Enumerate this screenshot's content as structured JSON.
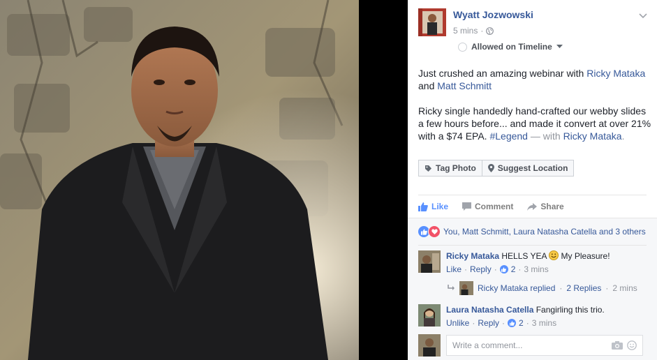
{
  "post": {
    "author": "Wyatt Jozwowski",
    "time": "5 mins",
    "dot": "·",
    "visibility": "Allowed on Timeline",
    "body_p1_prefix": "Just crushed an amazing webinar with ",
    "tag1": "Ricky Mataka",
    "and": " and ",
    "tag2": "Matt Schmitt",
    "body_p2": "Ricky single handedly hand-crafted our webby slides a few hours before... and made it convert at over 21% with a $74 EPA. ",
    "hashtag": "#Legend",
    "with_text": " — with ",
    "with_person": "Ricky Mataka",
    "with_end": ".",
    "tag_photo": "Tag Photo",
    "suggest_location": "Suggest Location"
  },
  "actions": {
    "like": "Like",
    "comment": "Comment",
    "share": "Share"
  },
  "reactions": {
    "text": "You, Matt Schmitt, Laura Natasha Catella and 3 others"
  },
  "comments": [
    {
      "name": "Ricky Mataka",
      "text": " HELLS YEA ",
      "text_after": " My Pleasure!",
      "action": "Like",
      "reply": "Reply",
      "likes": "2",
      "time": "3 mins",
      "sep": "·"
    },
    {
      "name": "Laura Natasha Catella",
      "text": " Fangirling this trio.",
      "action": "Unlike",
      "reply": "Reply",
      "likes": "2",
      "time": "3 mins",
      "sep": "·"
    }
  ],
  "reply_summary": {
    "text": "Ricky Mataka replied",
    "sep": "·",
    "replies": "2 Replies",
    "time": "2 mins"
  },
  "composer": {
    "placeholder": "Write a comment..."
  },
  "colors": {
    "link": "#365899",
    "like_blue": "#5890ff",
    "love_red": "#f25268"
  }
}
